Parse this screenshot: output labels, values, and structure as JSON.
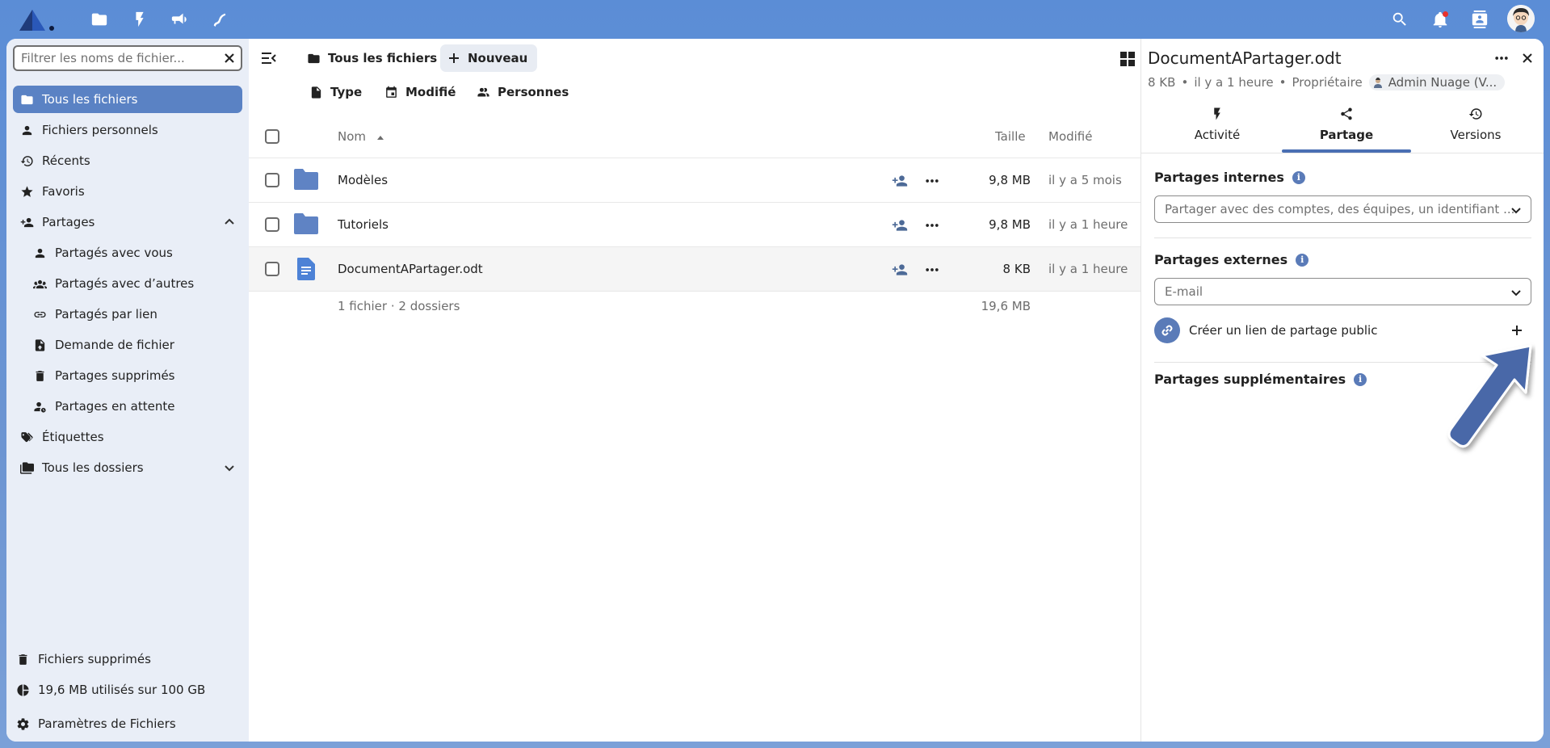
{
  "header": {
    "logo": "nextcloud-logo",
    "apps": [
      "files-icon",
      "activity-icon",
      "announcements-icon",
      "talk-icon"
    ],
    "right": [
      "search-icon",
      "notifications-icon",
      "contacts-icon",
      "user-avatar"
    ]
  },
  "nav": {
    "filter_placeholder": "Filtrer les noms de fichier...",
    "items": [
      {
        "label": "Tous les fichiers",
        "icon": "folder-icon",
        "active": true
      },
      {
        "label": "Fichiers personnels",
        "icon": "account-icon"
      },
      {
        "label": "Récents",
        "icon": "history-icon"
      },
      {
        "label": "Favoris",
        "icon": "star-icon"
      },
      {
        "label": "Partages",
        "icon": "share-icon",
        "expanded": true
      }
    ],
    "shares_sub": [
      {
        "label": "Partagés avec vous",
        "icon": "account-icon"
      },
      {
        "label": "Partagés avec d’autres",
        "icon": "account-group-icon"
      },
      {
        "label": "Partagés par lien",
        "icon": "link-icon"
      },
      {
        "label": "Demande de fichier",
        "icon": "file-upload-icon"
      },
      {
        "label": "Partages supprimés",
        "icon": "trash-icon"
      },
      {
        "label": "Partages en attente",
        "icon": "account-clock-icon"
      }
    ],
    "items2": [
      {
        "label": "Étiquettes",
        "icon": "tag-icon"
      },
      {
        "label": "Tous les dossiers",
        "icon": "folder-multiple-icon"
      }
    ],
    "bottom": {
      "trash": "Fichiers supprimés",
      "quota": "19,6 MB utilisés sur 100 GB",
      "settings": "Paramètres de Fichiers"
    }
  },
  "files": {
    "breadcrumb": "Tous les fichiers",
    "new_label": "Nouveau",
    "filters": {
      "type": "Type",
      "modified": "Modifié",
      "people": "Personnes"
    },
    "columns": {
      "name": "Nom",
      "size": "Taille",
      "modified": "Modifié"
    },
    "rows": [
      {
        "name": "Modèles",
        "type": "folder",
        "size": "9,8 MB",
        "modified": "il y a 5 mois"
      },
      {
        "name": "Tutoriels",
        "type": "folder",
        "size": "9,8 MB",
        "modified": "il y a 1 heure"
      },
      {
        "name": "DocumentAPartager.odt",
        "type": "document",
        "size": "8 KB",
        "modified": "il y a 1 heure",
        "selected": true
      }
    ],
    "summary": "1 fichier · 2 dossiers",
    "total_size": "19,6 MB"
  },
  "details": {
    "title": "DocumentAPartager.odt",
    "size": "8 KB",
    "age": "il y a 1 heure",
    "owner_label": "Propriétaire",
    "owner_name": "Admin Nuage (V...",
    "tabs": {
      "activity": "Activité",
      "sharing": "Partage",
      "versions": "Versions"
    },
    "internal_title": "Partages internes",
    "internal_placeholder": "Partager avec des comptes, des équipes, un identifiant ...",
    "external_title": "Partages externes",
    "external_placeholder": "E-mail",
    "public_link_label": "Créer un lien de partage public",
    "additional_title": "Partages supplémentaires"
  },
  "colors": {
    "accent": "#5a82c4",
    "annotation_arrow": "#4a68a8"
  }
}
